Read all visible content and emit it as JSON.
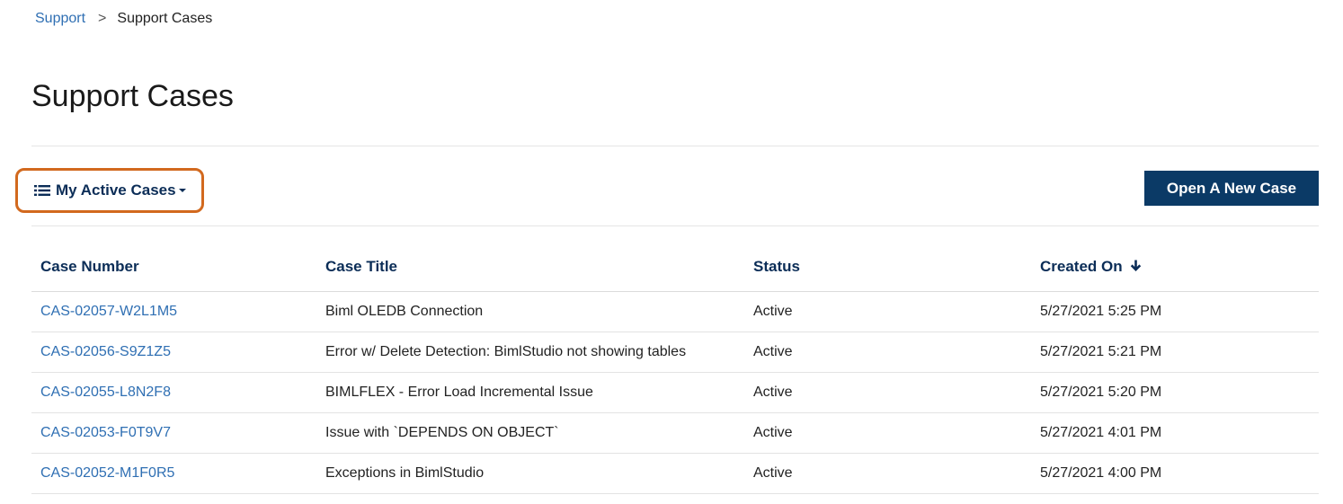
{
  "breadcrumb": {
    "parent": "Support",
    "separator": ">",
    "current": "Support Cases"
  },
  "page": {
    "title": "Support Cases"
  },
  "toolbar": {
    "view_label": "My Active Cases",
    "new_case_label": "Open A New Case"
  },
  "table": {
    "headers": {
      "case_number": "Case Number",
      "case_title": "Case Title",
      "status": "Status",
      "created_on": "Created On"
    },
    "sort": {
      "column": "created_on",
      "direction": "descending"
    },
    "rows": [
      {
        "case_number": "CAS-02057-W2L1M5",
        "title": "Biml OLEDB Connection",
        "status": "Active",
        "created_on": "5/27/2021 5:25 PM"
      },
      {
        "case_number": "CAS-02056-S9Z1Z5",
        "title": "Error w/ Delete Detection: BimlStudio not showing tables",
        "status": "Active",
        "created_on": "5/27/2021 5:21 PM"
      },
      {
        "case_number": "CAS-02055-L8N2F8",
        "title": "BIMLFLEX - Error Load Incremental Issue",
        "status": "Active",
        "created_on": "5/27/2021 5:20 PM"
      },
      {
        "case_number": "CAS-02053-F0T9V7",
        "title": "Issue with `DEPENDS ON OBJECT`",
        "status": "Active",
        "created_on": "5/27/2021 4:01 PM"
      },
      {
        "case_number": "CAS-02052-M1F0R5",
        "title": "Exceptions in BimlStudio",
        "status": "Active",
        "created_on": "5/27/2021 4:00 PM"
      }
    ]
  },
  "colors": {
    "link": "#2f6fb3",
    "header_text": "#0b2d57",
    "button_bg": "#0b3a66",
    "highlight_border": "#d2691e"
  },
  "icons": {
    "view": "list-icon",
    "view_caret": "caret-down-icon",
    "sort": "arrow-down-icon"
  }
}
